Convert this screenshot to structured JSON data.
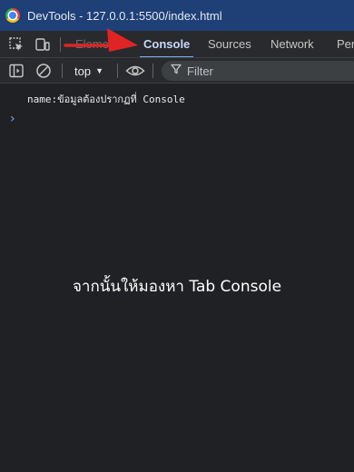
{
  "window": {
    "title": "DevTools - 127.0.0.1:5500/index.html",
    "icon": "chrome-icon"
  },
  "devtools": {
    "toolbar_icons": [
      "inspect-element-icon",
      "device-toolbar-icon"
    ],
    "tabs": [
      {
        "label": "Element",
        "active": false
      },
      {
        "label": "Console",
        "active": true
      },
      {
        "label": "Sources",
        "active": false
      },
      {
        "label": "Network",
        "active": false
      },
      {
        "label": "Per",
        "active": false
      }
    ]
  },
  "console_toolbar": {
    "icons": [
      "sidebar-toggle-icon",
      "clear-console-icon",
      "eye-icon",
      "filter-icon"
    ],
    "context": "top",
    "filter_placeholder": "Filter"
  },
  "console": {
    "log_line": "name:ข้อมูลต้องปรากฏที่ Console",
    "prompt_symbol": "›"
  },
  "annotation": {
    "caption": "จากนั้นให้มองหา Tab Console",
    "arrow_color": "#e02424"
  },
  "colors": {
    "titlebar": "#1f3f77",
    "toolbar": "#292a2d",
    "console_bg": "#202124",
    "active_tab": "#c6dafc",
    "active_underline": "#7cacf8"
  }
}
